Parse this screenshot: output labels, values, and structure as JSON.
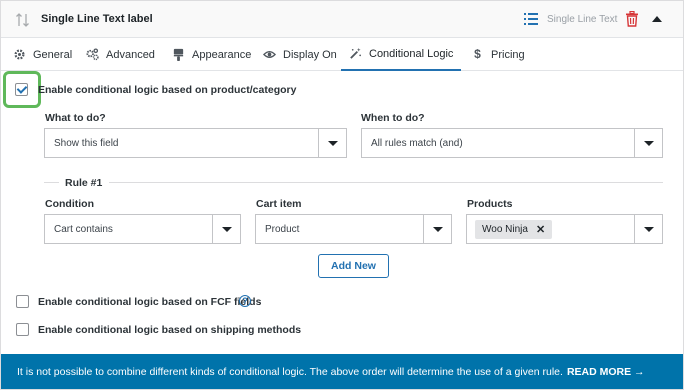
{
  "header": {
    "title": "Single Line Text label",
    "field_type": "Single Line Text",
    "colors": {
      "accent": "#2271b1",
      "delete": "#d63638"
    }
  },
  "tabs": [
    {
      "label": "General",
      "icon": "gear-icon"
    },
    {
      "label": "Advanced",
      "icon": "gears-icon"
    },
    {
      "label": "Appearance",
      "icon": "paint-brush-icon"
    },
    {
      "label": "Display On",
      "icon": "eye-icon"
    },
    {
      "label": "Conditional Logic",
      "icon": "magic-wand-icon",
      "active": true
    },
    {
      "label": "Pricing",
      "icon": "dollar-icon"
    }
  ],
  "conditional": {
    "enable_product_label": "Enable conditional logic based on product/category",
    "enable_product_checked": true,
    "what_to_do_label": "What to do?",
    "what_to_do_value": "Show this field",
    "when_to_do_label": "When to do?",
    "when_to_do_value": "All rules match (and)",
    "rule_title": "Rule #1",
    "condition_label": "Condition",
    "condition_value": "Cart contains",
    "cart_item_label": "Cart item",
    "cart_item_value": "Product",
    "products_label": "Products",
    "products_tag": "Woo Ninja",
    "add_new_label": "Add New",
    "enable_fcf_label": "Enable conditional logic based on FCF fields",
    "enable_shipping_label": "Enable conditional logic based on shipping methods"
  },
  "notice": {
    "text": "It is not possible to combine different kinds of conditional logic. The above order will determine the use of a given rule.",
    "link": "READ MORE →",
    "color": "#0073aa"
  }
}
